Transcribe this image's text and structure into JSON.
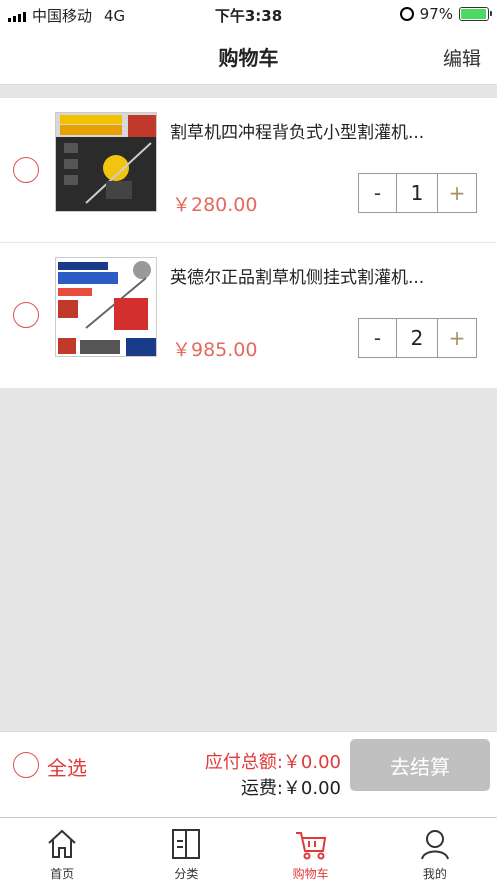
{
  "status_bar": {
    "carrier": "中国移动",
    "network": "4G",
    "time": "下午3:38",
    "battery_percent": "97%",
    "battery_level": 0.97,
    "battery_color": "#4cd964"
  },
  "header": {
    "title": "购物车",
    "edit_label": "编辑"
  },
  "cart": {
    "items": [
      {
        "title": "割草机四冲程背负式小型割灌机...",
        "price": "￥280.00",
        "quantity": "1",
        "minus": "-",
        "plus": "+",
        "image_icon": "product-image-brush-cutter",
        "selected": false
      },
      {
        "title": "英德尔正品割草机侧挂式割灌机...",
        "price": "￥985.00",
        "quantity": "2",
        "minus": "-",
        "plus": "+",
        "image_icon": "product-image-indel-cutter",
        "selected": false
      }
    ]
  },
  "summary": {
    "select_all_label": "全选",
    "total_label": "应付总额:￥0.00",
    "shipping_label": "运费:￥0.00",
    "checkout_label": "去结算"
  },
  "tab_bar": {
    "tabs": [
      {
        "label": "首页",
        "icon": "home-icon",
        "active": false
      },
      {
        "label": "分类",
        "icon": "category-icon",
        "active": false
      },
      {
        "label": "购物车",
        "icon": "cart-icon",
        "active": true
      },
      {
        "label": "我的",
        "icon": "profile-icon",
        "active": false
      }
    ]
  },
  "colors": {
    "accent_red": "#e03a3a",
    "price_red": "#e26a5f",
    "checkout_disabled": "#c0c0c0",
    "page_background": "#e5e5e5"
  }
}
